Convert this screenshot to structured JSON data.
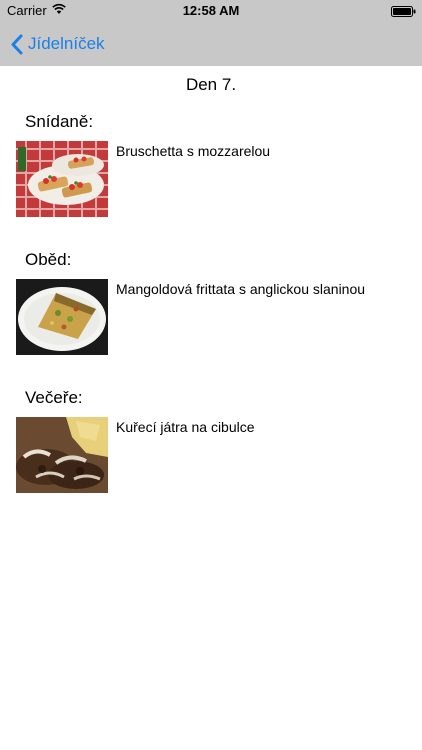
{
  "status_bar": {
    "carrier": "Carrier",
    "time": "12:58 AM"
  },
  "nav": {
    "back_label": "Jídelníček",
    "accent_color": "#1a7fe8"
  },
  "day": {
    "title": "Den 7."
  },
  "meals": [
    {
      "heading": "Snídaně:",
      "dish": "Bruschetta s mozzarelou"
    },
    {
      "heading": "Oběd:",
      "dish": "Mangoldová frittata s anglickou slaninou"
    },
    {
      "heading": "Večeře:",
      "dish": "Kuřecí játra na cibulce"
    }
  ]
}
